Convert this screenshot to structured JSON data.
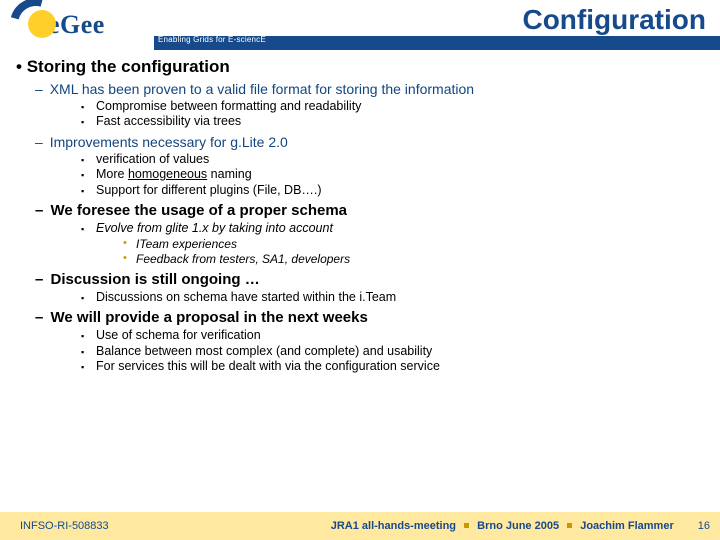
{
  "header": {
    "logo_text": "eGee",
    "tagline": "Enabling Grids for E-sciencE",
    "title": "Configuration"
  },
  "content": {
    "heading": "Storing the configuration",
    "item1": {
      "text": "XML has been proven to a valid file format for storing the information",
      "sub": [
        "Compromise between formatting and readability",
        "Fast accessibility via trees"
      ]
    },
    "item2": {
      "text": "Improvements necessary for g.Lite 2.0",
      "sub": [
        "verification of values",
        "More ",
        "homogeneous",
        " naming",
        "Support for different plugins (File, DB….)"
      ]
    },
    "item3": {
      "text": "We foresee the usage of a proper schema",
      "sub1": "Evolve from glite 1.x by taking into account",
      "subsub": [
        "ITeam experiences",
        "Feedback from testers, SA1, developers"
      ]
    },
    "item4": {
      "text": "Discussion is still ongoing …",
      "sub1": "Discussions on schema have started within the i.Team"
    },
    "item5": {
      "text": "We will provide a proposal in the next weeks",
      "sub": [
        "Use of schema for verification",
        "Balance between most complex (and complete) and usability",
        "For services this will be dealt with via the configuration service"
      ]
    }
  },
  "footer": {
    "left": "INFSO-RI-508833",
    "right_meeting": "JRA1 all-hands-meeting",
    "right_place": "Brno June 2005",
    "right_author": "Joachim Flammer",
    "page": "16"
  }
}
